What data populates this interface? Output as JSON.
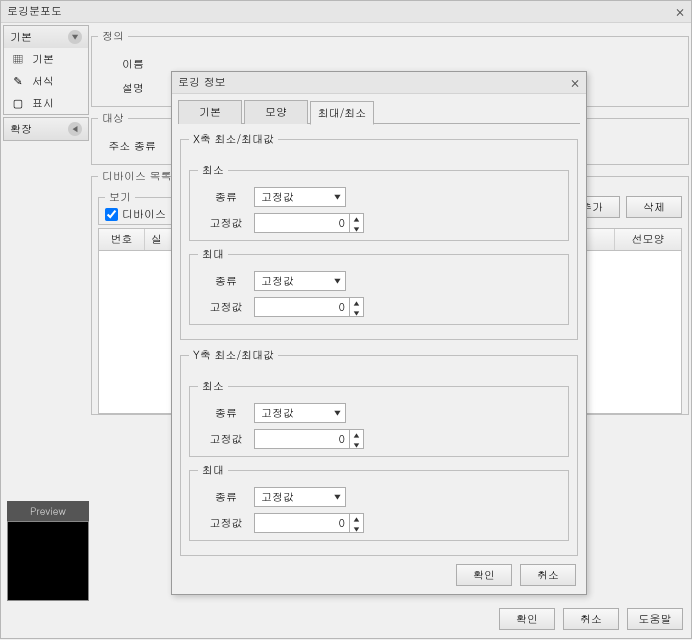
{
  "window": {
    "title": "로깅분포도",
    "close_icon": "⨯"
  },
  "sidebar": {
    "section1": {
      "label": "기본"
    },
    "items1": [
      {
        "label": "기본"
      },
      {
        "label": "서식"
      },
      {
        "label": "표시"
      }
    ],
    "section2": {
      "label": "확장"
    }
  },
  "def": {
    "legend": "정의",
    "name_label": "이름",
    "desc_label": "설명"
  },
  "target": {
    "legend": "대상",
    "address_type_label": "주소 종류"
  },
  "device": {
    "legend": "디바이스 목록",
    "show_group": "보기",
    "show_checkbox": "디바이스",
    "add_btn": "추가",
    "del_btn": "삭제",
    "cols": {
      "no": "번호",
      "name": "실",
      "style": "선모양"
    }
  },
  "preview_label": "Preview",
  "bottom": {
    "ok": "확인",
    "cancel": "취소",
    "help": "도움말"
  },
  "modal": {
    "title": "로깅 정보",
    "close_icon": "⨯",
    "tabs": {
      "basic": "기본",
      "shape": "모양",
      "minmax": "최대/최소"
    },
    "x_axis": "X축 최소/최대값",
    "y_axis": "Y축 최소/최대값",
    "min_label": "최소",
    "max_label": "최대",
    "type_label": "종류",
    "fixed_label": "고정값",
    "type_value": "고정값",
    "fixed_value": "0",
    "ok": "확인",
    "cancel": "취소"
  }
}
